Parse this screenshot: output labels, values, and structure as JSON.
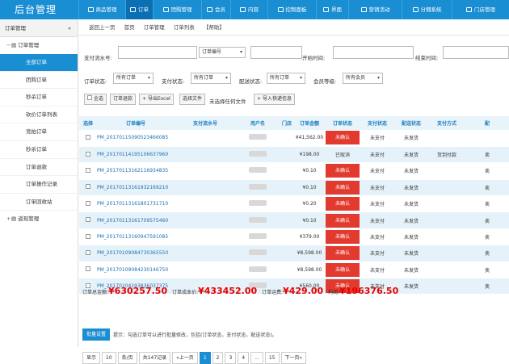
{
  "app": {
    "title": "后台管理"
  },
  "nav": [
    "商品管理",
    "订单",
    "团购管理",
    "会员",
    "内容",
    "控制面板",
    "界面",
    "营销活动",
    "分佣系统",
    "门店管理"
  ],
  "side": {
    "header": "订单管理",
    "arrow": "«",
    "group1": "订单管理",
    "items": [
      "全部订单",
      "团购订单",
      "秒杀订单",
      "砍价订单列表",
      "竞拍订单",
      "秒杀订单",
      "订单退款",
      "订单操作记录",
      "订单回收站"
    ],
    "group2": "返现管理"
  },
  "crumb": {
    "back": "返回上一页",
    "home": "首页",
    "path1": "订单管理",
    "path2": "订单列表",
    "help": "【帮助】"
  },
  "filter": {
    "pay_no": "支付流水号:",
    "order_select": "订单编号",
    "start": "开始时间:",
    "end": "结束时间:",
    "order_status": "订单状态:",
    "order_status_val": "所有订单",
    "pay_status": "支付状态:",
    "pay_status_val": "所有订单",
    "ship_status": "配送状态:",
    "ship_status_val": "所有订单",
    "member": "会员等级:",
    "member_val": "所有会员"
  },
  "toolbar": {
    "all": "全选",
    "refund": "订单退款",
    "export": "导出Excel",
    "choose": "选择文件",
    "nofile": "未选择任何文件",
    "import": "导入快递信息"
  },
  "headers": [
    "选择",
    "订单编号",
    "支付流水号",
    "用户名",
    "门店",
    "订单金额",
    "订单状态",
    "支付状态",
    "配送状态",
    "支付方式",
    "配"
  ],
  "rows": [
    {
      "no": "PM_20170115090523466085",
      "amount": "¥41,562.00",
      "status": "未确认",
      "red": true,
      "pay": "未支付",
      "ship": "未发货",
      "method": "",
      "last": ""
    },
    {
      "no": "PM_20170114195106637960",
      "amount": "¥198.00",
      "status": "已取消",
      "red": false,
      "pay": "未支付",
      "ship": "未发货",
      "method": "货到付款",
      "last": "卖"
    },
    {
      "no": "PM_20170113162116934835",
      "amount": "¥0.10",
      "status": "未确认",
      "red": true,
      "pay": "未支付",
      "ship": "未发货",
      "method": "",
      "last": "卖"
    },
    {
      "no": "PM_20170113161932169210",
      "amount": "¥0.10",
      "status": "未确认",
      "red": true,
      "pay": "未支付",
      "ship": "未发货",
      "method": "",
      "last": "卖"
    },
    {
      "no": "PM_20170113161801731710",
      "amount": "¥0.20",
      "status": "未确认",
      "red": true,
      "pay": "未支付",
      "ship": "未发货",
      "method": "",
      "last": "卖"
    },
    {
      "no": "PM_20170113161709575460",
      "amount": "¥0.10",
      "status": "未确认",
      "red": true,
      "pay": "未支付",
      "ship": "未发货",
      "method": "",
      "last": "卖"
    },
    {
      "no": "PM_20170113160947591085",
      "amount": "¥379.00",
      "status": "未确认",
      "red": true,
      "pay": "未支付",
      "ship": "未发货",
      "method": "",
      "last": "卖"
    },
    {
      "no": "PM_20170109084730365550",
      "amount": "¥8,598.00",
      "status": "未确认",
      "red": true,
      "pay": "未支付",
      "ship": "未发货",
      "method": "",
      "last": "卖"
    },
    {
      "no": "PM_20170109084230146750",
      "amount": "¥8,598.00",
      "status": "未确认",
      "red": true,
      "pay": "未支付",
      "ship": "未发货",
      "method": "",
      "last": "卖"
    },
    {
      "no": "PM_20170104193836037375",
      "amount": "¥560.00",
      "status": "未确认",
      "red": true,
      "pay": "未支付",
      "ship": "未发货",
      "method": "",
      "last": "卖"
    }
  ],
  "summary": {
    "total_l": "订单总金额:",
    "total": "¥630257.50",
    "cost_l": "订单成本价:",
    "cost": "¥433452.00",
    "fee_l": "订单运费:",
    "fee": "¥429.00",
    "profit_l": "利润:",
    "profit": "¥196376.50"
  },
  "batch": {
    "label": "批量设置",
    "tip": "提示：勾选订单可以进行批量修改，包括(订单状态，支付状态，配送状态)。"
  },
  "pager": {
    "show": "显示",
    "size": "10",
    "per": "条/页",
    "total": "共147记录",
    "prev": "«上一页",
    "p1": "1",
    "p2": "2",
    "p3": "3",
    "p4": "4",
    "dots": "...",
    "p15": "15",
    "next": "下一页»"
  }
}
